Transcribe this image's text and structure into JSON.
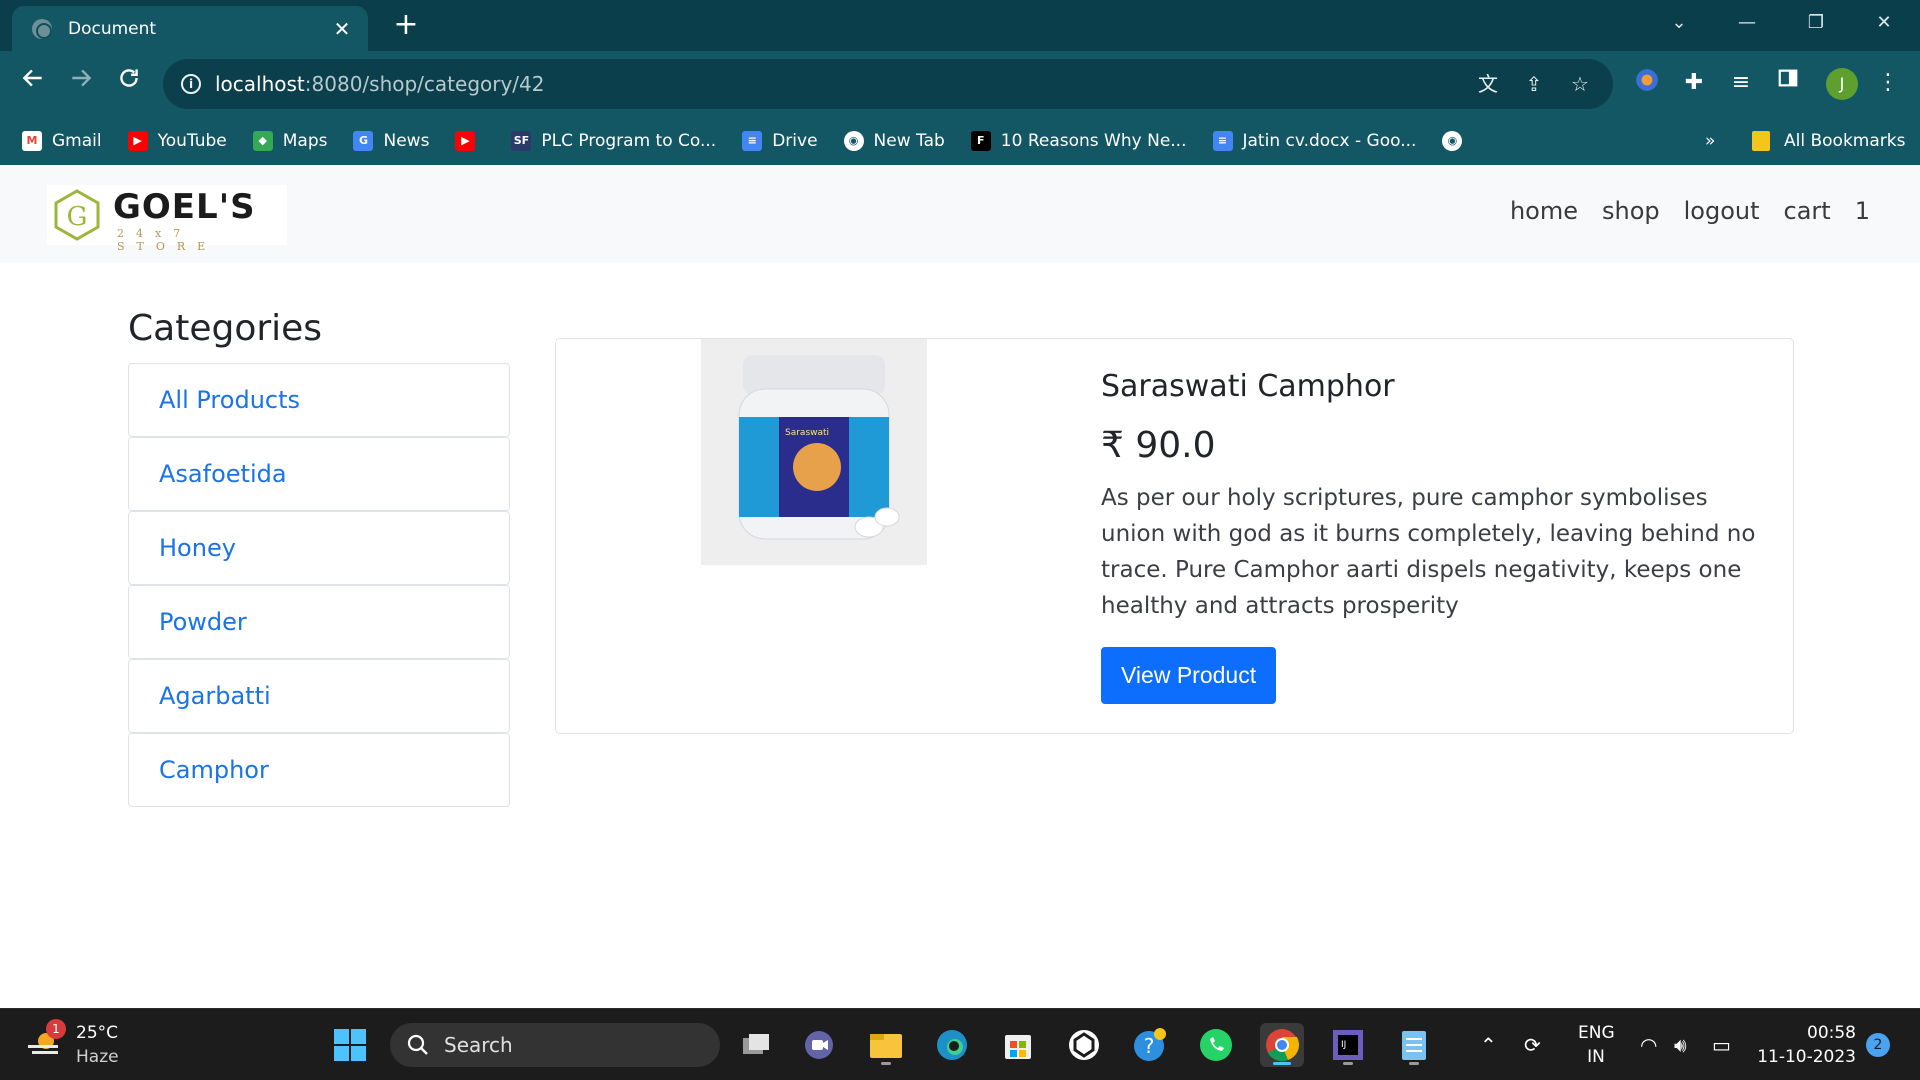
{
  "browser": {
    "tab_title": "Document",
    "tab_close": "✕",
    "new_tab": "+",
    "url_host": "localhost",
    "url_rest": ":8080/shop/category/42",
    "window_controls": [
      "⌄",
      "—",
      "❐",
      "✕"
    ]
  },
  "bookmarks": {
    "items": [
      {
        "label": "Gmail",
        "icon": "gmail-icon",
        "color": "#ea4335"
      },
      {
        "label": "YouTube",
        "icon": "youtube-icon",
        "color": "#ff0000"
      },
      {
        "label": "Maps",
        "icon": "maps-icon",
        "color": "#34a853"
      },
      {
        "label": "News",
        "icon": "news-icon",
        "color": "#4285f4"
      },
      {
        "label": "",
        "icon": "youtube-icon",
        "color": "#ff0000"
      },
      {
        "label": "PLC Program to Co...",
        "icon": "plc-icon",
        "color": "#2b3a67"
      },
      {
        "label": "Drive",
        "icon": "docs-icon",
        "color": "#4285f4"
      },
      {
        "label": "New Tab",
        "icon": "globe-icon",
        "color": "#ffffff"
      },
      {
        "label": "10 Reasons Why Ne...",
        "icon": "forbes-icon",
        "color": "#000000"
      },
      {
        "label": "Jatin cv.docx - Goo...",
        "icon": "docs-icon",
        "color": "#4285f4"
      },
      {
        "label": "",
        "icon": "globe-icon",
        "color": "#ffffff"
      }
    ],
    "overflow": "»",
    "all_bookmarks": "All Bookmarks"
  },
  "profile_initial": "J",
  "site": {
    "logo_text": "GOEL'S",
    "logo_sub": "24x7 STORE",
    "nav": {
      "home": "home",
      "shop": "shop",
      "logout": "logout",
      "cart": "cart",
      "cart_count": "1"
    }
  },
  "categories": {
    "title": "Categories",
    "items": [
      "All Products",
      "Asafoetida",
      "Honey",
      "Powder",
      "Agarbatti",
      "Camphor"
    ]
  },
  "product": {
    "name": "Saraswati Camphor",
    "price": "₹ 90.0",
    "description": "As per our holy scriptures, pure camphor symbolises union with god as it burns completely, leaving behind no trace. Pure Camphor aarti dispels negativity, keeps one healthy and attracts prosperity",
    "button": "View Product",
    "image_label": "Saraswati"
  },
  "taskbar": {
    "weather_badge": "1",
    "temperature": "25°C",
    "condition": "Haze",
    "search_label": "Search",
    "lang_top": "ENG",
    "lang_bottom": "IN",
    "time": "00:58",
    "date": "11-10-2023",
    "notifications": "2"
  }
}
